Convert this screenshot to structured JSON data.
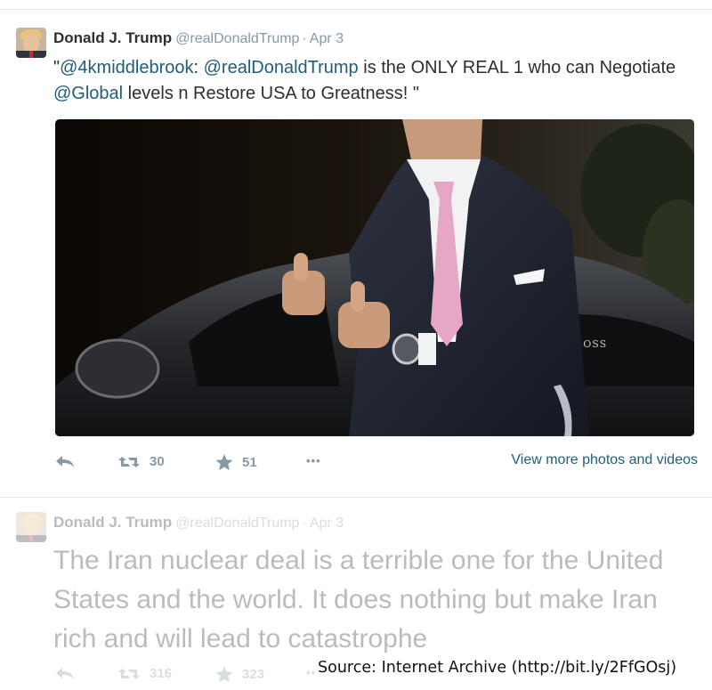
{
  "tweets": [
    {
      "author_name": "Donald J. Trump",
      "handle": "@realDonaldTrump",
      "separator": "·",
      "date": "Apr 3",
      "text_parts": [
        "\"",
        "@4kmiddlebrook",
        ": ",
        "@realDonaldTrump",
        " is the ONLY REAL 1 who can Negotiate ",
        "@Global",
        " levels n Restore USA to Greatness! \""
      ],
      "retweets": "30",
      "favorites": "51",
      "more": "•••",
      "view_more_label": "View more photos and videos",
      "photo_badge_text": "BOSS"
    },
    {
      "author_name": "Donald J. Trump",
      "handle": "@realDonaldTrump",
      "separator": "·",
      "date": "Apr 3",
      "text": "The Iran nuclear deal is a terrible one for the United States and the world. It does nothing but make Iran rich and will lead to catastrophe",
      "retweets": "316",
      "favorites": "323",
      "more": "•••"
    }
  ],
  "caption": "Source: Internet Archive (http://bit.ly/2FfGOsj)",
  "colors": {
    "link": "#1f5d7a",
    "muted": "#8899a6",
    "text": "#292f33",
    "divider": "#e1e8ed"
  },
  "icons": [
    "reply-icon",
    "retweet-icon",
    "star-icon",
    "more-icon"
  ]
}
